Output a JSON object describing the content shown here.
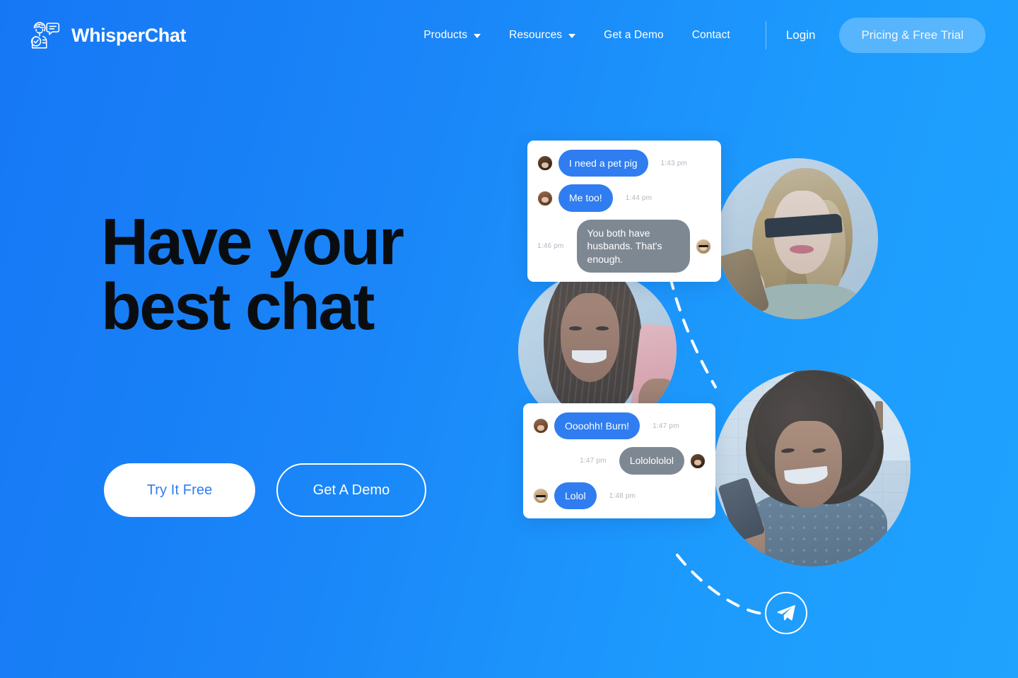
{
  "brand": {
    "name": "WhisperChat",
    "logo_icon": "whispering-person-speech-bubble-icon"
  },
  "nav": {
    "items": [
      {
        "label": "Products",
        "has_dropdown": true,
        "icon": "chevron-down-icon"
      },
      {
        "label": "Resources",
        "has_dropdown": true,
        "icon": "chevron-down-icon"
      },
      {
        "label": "Get a Demo",
        "has_dropdown": false,
        "icon": ""
      },
      {
        "label": "Contact",
        "has_dropdown": false,
        "icon": ""
      }
    ],
    "login_label": "Login",
    "cta_label": "Pricing & Free Trial"
  },
  "hero": {
    "headline_line1": "Have your",
    "headline_line2": "best chat",
    "primary_button": "Try It Free",
    "secondary_button": "Get A Demo"
  },
  "photos": [
    {
      "name": "blonde-woman-sunglasses-phone"
    },
    {
      "name": "braided-woman-pink-phone"
    },
    {
      "name": "curly-haired-woman-kitchen-phone"
    }
  ],
  "send_icon": "paper-plane-send-icon",
  "chat_cards": [
    {
      "id": "top",
      "messages": [
        {
          "text": "I need a pet pig",
          "time": "1:43 pm",
          "side": "left",
          "color": "blue",
          "avatar": "av-a"
        },
        {
          "text": "Me too!",
          "time": "1:44 pm",
          "side": "left",
          "color": "blue",
          "avatar": "av-b"
        },
        {
          "text": "You both have husbands. That's enough.",
          "time": "1:46 pm",
          "side": "right",
          "color": "grey",
          "avatar": "av-c"
        }
      ]
    },
    {
      "id": "bottom",
      "messages": [
        {
          "text": "Oooohh! Burn!",
          "time": "1:47 pm",
          "side": "left",
          "color": "blue",
          "avatar": "av-b"
        },
        {
          "text": "Lololololol",
          "time": "1:47 pm",
          "side": "right",
          "color": "grey",
          "avatar": "av-a"
        },
        {
          "text": "Lolol",
          "time": "1:48 pm",
          "side": "left",
          "color": "blue",
          "avatar": "av-c"
        }
      ]
    }
  ],
  "colors": {
    "bg_gradient_start": "#1677f5",
    "bg_gradient_end": "#1fa3fe",
    "bubble_blue": "#2f7df0",
    "bubble_grey": "#7e8893",
    "headline": "#0a0d10",
    "button_text_blue": "#2f7df0",
    "timestamp": "#b1b7bf"
  }
}
